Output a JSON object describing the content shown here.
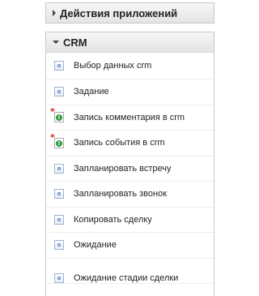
{
  "sections": {
    "app_actions": {
      "title": "Действия приложений",
      "state": "collapsed"
    },
    "crm": {
      "title": "CRM",
      "state": "expanded",
      "items": [
        {
          "label": "Выбор данных crm",
          "icon": "activity-icon"
        },
        {
          "label": "Задание",
          "icon": "activity-icon"
        },
        {
          "label": "Запись комментария в crm",
          "icon": "required-info-icon"
        },
        {
          "label": "Запись события в crm",
          "icon": "required-info-icon"
        },
        {
          "label": "Запланировать встречу",
          "icon": "activity-icon"
        },
        {
          "label": "Запланировать звонок",
          "icon": "activity-icon"
        },
        {
          "label": "Копировать сделку",
          "icon": "activity-icon"
        },
        {
          "label": "Ожидание",
          "icon": "activity-icon"
        },
        {
          "label": "Ожидание стадии сделки",
          "icon": "activity-icon"
        }
      ]
    }
  },
  "colors": {
    "warning_star": "#e01b1b",
    "info_dot": "#2e9a3a",
    "icon_border": "#9fb3cf"
  }
}
